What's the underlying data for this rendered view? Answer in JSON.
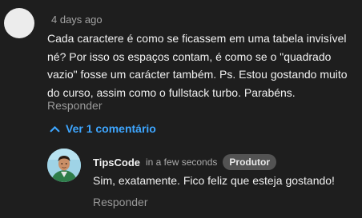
{
  "comment": {
    "timestamp": "4 days ago",
    "text": "Cada caractere é como se ficassem em uma tabela invisível né? Por isso os espaços contam, é como se o \"quadrado vazio\" fosse um carácter também. Ps. Estou gostando muito do curso, assim como o fullstack turbo. Parabéns.",
    "reply_label": "Responder"
  },
  "replies_toggle": {
    "label": "Ver 1 comentário",
    "icon": "chevron-up-icon",
    "color": "#3ea6ff"
  },
  "reply": {
    "author": "TipsCode",
    "time": "in a few seconds",
    "badge": "Produtor",
    "text": "Sim, exatamente. Fico feliz que esteja gostando!",
    "reply_label": "Responder"
  },
  "colors": {
    "background": "#1e1e1e",
    "text": "#f1f1f1",
    "muted": "#9a9a9a",
    "accent": "#3ea6ff",
    "badge_bg": "#535353"
  }
}
